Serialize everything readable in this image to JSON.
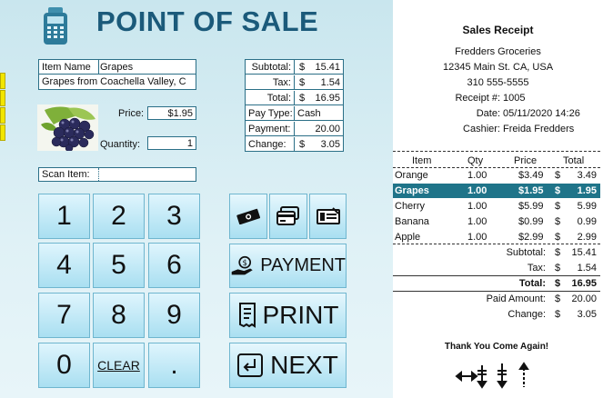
{
  "app": {
    "title": "POINT OF SALE"
  },
  "item": {
    "name_label": "Item Name",
    "name_value": "Grapes",
    "description": "Grapes from Coachella Valley, C",
    "price_label": "Price:",
    "price_value": "$1.95",
    "quantity_label": "Quantity:",
    "quantity_value": "1",
    "scan_label": "Scan Item:",
    "scan_value": ""
  },
  "totals": {
    "subtotal_label": "Subtotal:",
    "subtotal_cur": "$",
    "subtotal_value": "15.41",
    "tax_label": "Tax:",
    "tax_cur": "$",
    "tax_value": "1.54",
    "total_label": "Total:",
    "total_cur": "$",
    "total_value": "16.95",
    "paytype_label": "Pay Type:",
    "paytype_value": "Cash",
    "payment_label": "Payment:",
    "payment_value": "20.00",
    "change_label": "Change:",
    "change_cur": "$",
    "change_value": "3.05"
  },
  "keypad": [
    "1",
    "2",
    "3",
    "4",
    "5",
    "6",
    "7",
    "8",
    "9",
    "0",
    "CLEAR",
    "."
  ],
  "actions": {
    "payment": "PAYMENT",
    "print": "PRINT",
    "next": "NEXT"
  },
  "receipt": {
    "title": "Sales Receipt",
    "store": "Fredders Groceries",
    "address": "12345 Main St. CA, USA",
    "phone": "310 555-5555",
    "receipt_no_label": "Receipt #:",
    "receipt_no": "1005",
    "date_label": "Date:",
    "date": "05/11/2020 14:26",
    "cashier_label": "Cashier:",
    "cashier": "Freida Fredders",
    "headers": {
      "item": "Item",
      "qty": "Qty",
      "price": "Price",
      "total": "Total"
    },
    "rows": [
      {
        "item": "Orange",
        "qty": "1.00",
        "price": "$3.49",
        "cur": "$",
        "total": "3.49",
        "selected": false
      },
      {
        "item": "Grapes",
        "qty": "1.00",
        "price": "$1.95",
        "cur": "$",
        "total": "1.95",
        "selected": true
      },
      {
        "item": "Cherry",
        "qty": "1.00",
        "price": "$5.99",
        "cur": "$",
        "total": "5.99",
        "selected": false
      },
      {
        "item": "Banana",
        "qty": "1.00",
        "price": "$0.99",
        "cur": "$",
        "total": "0.99",
        "selected": false
      },
      {
        "item": "Apple",
        "qty": "1.00",
        "price": "$2.99",
        "cur": "$",
        "total": "2.99",
        "selected": false
      }
    ],
    "subtotal_label": "Subtotal:",
    "subtotal_cur": "$",
    "subtotal": "15.41",
    "tax_label": "Tax:",
    "tax_cur": "$",
    "tax": "1.54",
    "total_label": "Total:",
    "total_cur": "$",
    "total": "16.95",
    "paid_label": "Paid Amount:",
    "paid_cur": "$",
    "paid": "20.00",
    "change_label": "Change:",
    "change_cur": "$",
    "change": "3.05",
    "footer": "Thank You Come Again!"
  },
  "colors": {
    "title": "#1b5a7a",
    "accent": "#1f7489",
    "border": "#2b6f87",
    "key_top": "#dff5fd",
    "key_bottom": "#a9dff1"
  },
  "icons": [
    "pos-terminal-icon",
    "cash-icon",
    "credit-card-icon",
    "check-icon",
    "hand-coin-icon",
    "receipt-icon",
    "enter-icon",
    "scroll-arrows-icon"
  ]
}
